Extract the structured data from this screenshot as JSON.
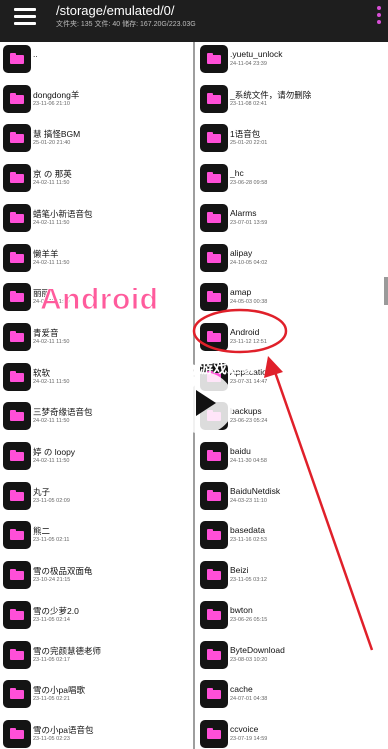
{
  "topbar": {
    "path": "/storage/emulated/0/",
    "stats": "文件夹: 135 文件: 40 储存: 167.20G/223.03G",
    "menu_icon": "hamburger-menu-icon",
    "more_icon": "more-vertical-icon"
  },
  "left_items": [
    {
      "name": "..",
      "date": ""
    },
    {
      "name": "dongdong羊",
      "date": "23-11-06 21:10"
    },
    {
      "name": "慧 搞怪BGM",
      "date": "25-01-20 21:40"
    },
    {
      "name": "京 の 那英",
      "date": "24-02-11 11:50"
    },
    {
      "name": "蜡笔小新语音包",
      "date": "24-02-11 11:50"
    },
    {
      "name": "懒羊羊",
      "date": "24-02-11 11:50"
    },
    {
      "name": "丽丽",
      "date": "24-02-11 11:50"
    },
    {
      "name": "青爱音",
      "date": "24-02-11 11:50"
    },
    {
      "name": "软软",
      "date": "24-02-11 11:50"
    },
    {
      "name": "三梦奇缘语音包",
      "date": "24-02-11 11:50"
    },
    {
      "name": "婷 の loopy",
      "date": "24-02-11 11:50"
    },
    {
      "name": "丸子",
      "date": "23-11-05 02:09"
    },
    {
      "name": "熊二",
      "date": "23-11-05 02:11"
    },
    {
      "name": "雪の极品双面龟",
      "date": "23-10-24 21:15"
    },
    {
      "name": "雪の少萝2.0",
      "date": "23-11-05 02:14"
    },
    {
      "name": "雪の完颜慧德老师",
      "date": "23-11-05 02:17"
    },
    {
      "name": "雪の小pa唱歌",
      "date": "23-11-05 02:21"
    },
    {
      "name": "雪の小pa语音包",
      "date": "23-11-05 02:23"
    }
  ],
  "right_items": [
    {
      "name": ".yuetu_unlock",
      "date": "24-11-04 23:39"
    },
    {
      "name": "_系统文件，请勿删除",
      "date": "23-11-08 02:41"
    },
    {
      "name": "1语音包",
      "date": "25-01-20 22:01"
    },
    {
      "name": "_hc",
      "date": "23-06-28 09:58"
    },
    {
      "name": "Alarms",
      "date": "23-07-01 13:59"
    },
    {
      "name": "alipay",
      "date": "24-10-05 04:02"
    },
    {
      "name": "amap",
      "date": "24-05-03 00:38"
    },
    {
      "name": "Android",
      "date": "23-11-12 12:51"
    },
    {
      "name": "Application",
      "date": "23-07-31 14:47"
    },
    {
      "name": "backups",
      "date": "23-06-23 05:24"
    },
    {
      "name": "baidu",
      "date": "24-11-30 04:58"
    },
    {
      "name": "BaiduNetdisk",
      "date": "24-03-23 11:10"
    },
    {
      "name": "basedata",
      "date": "23-11-16 02:53"
    },
    {
      "name": "Beizi",
      "date": "23-11-05 03:12"
    },
    {
      "name": "bwton",
      "date": "23-06-26 05:15"
    },
    {
      "name": "ByteDownload",
      "date": "23-08-03 10:20"
    },
    {
      "name": "cache",
      "date": "24-07-01 04:38"
    },
    {
      "name": "ccvoice",
      "date": "23-07-19 14:59"
    }
  ],
  "watermark": {
    "annotation_text": "Android",
    "site_logo": "K73",
    "site_logo_sub": "游戏之家",
    "accent_color": "#ff5b9c"
  },
  "colors": {
    "folder": "#ff4fd8",
    "highlight": "#e0202a"
  }
}
